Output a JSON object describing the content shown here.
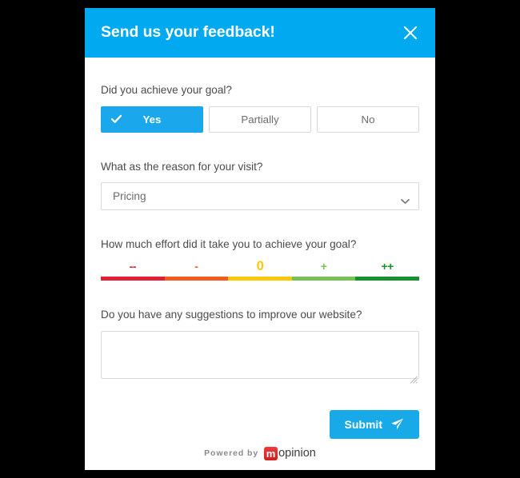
{
  "header": {
    "title": "Send us your feedback!",
    "close_icon": "close-icon",
    "background_color": "#00a9f0"
  },
  "questions": {
    "goal": {
      "label": "Did you achieve your goal?",
      "options": [
        {
          "label": "Yes",
          "selected": true,
          "icon": "check-icon"
        },
        {
          "label": "Partially",
          "selected": false
        },
        {
          "label": "No",
          "selected": false
        }
      ]
    },
    "reason": {
      "label": "What as the reason for your visit?",
      "selected_value": "Pricing",
      "chevron_icon": "chevron-down-icon"
    },
    "effort": {
      "label": "How much effort did it take you to achieve your goal?",
      "segments": [
        {
          "label": "--",
          "color": "#e41f35"
        },
        {
          "label": "-",
          "color": "#f4591f"
        },
        {
          "label": "0",
          "color": "#fbc707"
        },
        {
          "label": "+",
          "color": "#77c254"
        },
        {
          "label": "++",
          "color": "#17912e"
        }
      ]
    },
    "suggestions": {
      "label": "Do you have any suggestions to improve our website?",
      "value": "",
      "placeholder": ""
    }
  },
  "submit": {
    "label": "Submit",
    "icon": "paper-plane-icon",
    "color": "#18a9e8"
  },
  "footer": {
    "powered_by": "Powered by",
    "brand_mark": "m",
    "brand_name": "opinion",
    "brand_color": "#e02020"
  }
}
